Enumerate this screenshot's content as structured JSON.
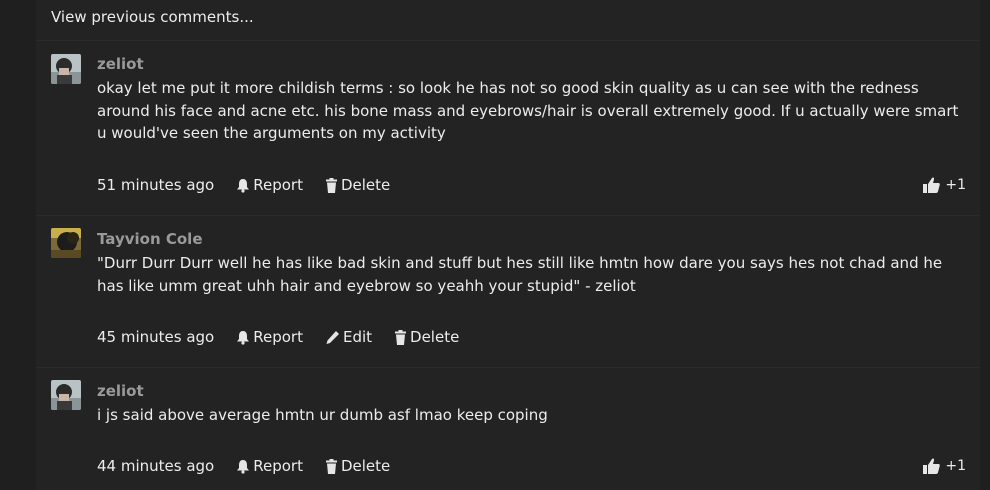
{
  "view_previous": "View previous comments...",
  "comments": [
    {
      "author": "zeliot",
      "text": "okay let me put it more childish terms : so look he has not so good skin quality as u can see with the redness around his face and acne etc. his bone mass and eyebrows/hair is overall extremely good. If u actually were smart u would've seen the arguments on my activity",
      "time": "51 minutes ago",
      "report": "Report",
      "delete": "Delete",
      "likes": "+1"
    },
    {
      "author": "Tayvion Cole",
      "text": "\"Durr Durr Durr well he has like bad skin and stuff but hes still like hmtn how dare you says hes not chad and he has like umm great uhh hair and eyebrow so yeahh your stupid\" - zeliot",
      "time": "45 minutes ago",
      "report": "Report",
      "edit": "Edit",
      "delete": "Delete"
    },
    {
      "author": "zeliot",
      "text": "i js said above average hmtn ur dumb asf lmao keep coping",
      "time": "44 minutes ago",
      "report": "Report",
      "delete": "Delete",
      "likes": "+1"
    }
  ]
}
